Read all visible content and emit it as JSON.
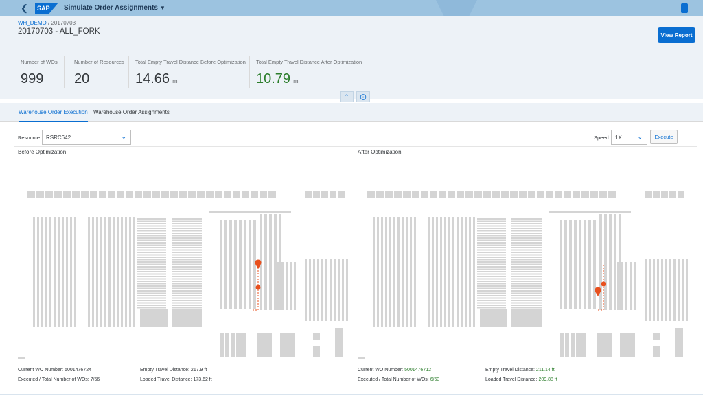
{
  "shell": {
    "logo": "SAP",
    "app_title": "Simulate Order Assignments"
  },
  "breadcrumb": {
    "link": "WH_DEMO",
    "sep": " / ",
    "current": "20170703"
  },
  "page_title": "20170703 - ALL_FORK",
  "view_report": "View Report",
  "kpis": {
    "wos": {
      "label": "Number of WOs",
      "value": "999"
    },
    "resources": {
      "label": "Number of Resources",
      "value": "20"
    },
    "before": {
      "label": "Total Empty Travel Distance Before Optimization",
      "value": "14.66",
      "unit": "mi"
    },
    "after": {
      "label": "Total Empty Travel Distance After Optimization",
      "value": "10.79",
      "unit": "mi"
    }
  },
  "tabs": [
    "Warehouse Order Execution",
    "Warehouse Order Assignments"
  ],
  "toolbar": {
    "resource_label": "Resource",
    "resource_value": "RSRC642",
    "speed_label": "Speed",
    "speed_value": "1X",
    "execute": "Execute"
  },
  "before": {
    "title": "Before Optimization",
    "wo_label": "Current WO Number:",
    "wo_value": "5001476724",
    "exec_label": "Executed / Total Number of WOs:",
    "exec_value": "7/56",
    "empty_label": "Empty Travel Distance:",
    "empty_value": "217.9 ft",
    "loaded_label": "Loaded Travel Distance:",
    "loaded_value": "173.62 ft"
  },
  "after": {
    "title": "After Optimization",
    "wo_label": "Current WO Number:",
    "wo_value": "5001476712",
    "exec_label": "Executed / Total Number of WOs:",
    "exec_value": "6/63",
    "empty_label": "Empty Travel Distance:",
    "empty_value": "211.14 ft",
    "loaded_label": "Loaded Travel Distance:",
    "loaded_value": "209.88 ft"
  },
  "colors": {
    "accent": "#0a6ed1",
    "shell": "#9cc3e0",
    "good": "#2b7d2b",
    "route": "#e8501e",
    "rack": "#d4d4d4"
  },
  "icons": {
    "back": "back-icon",
    "user": "user-icon",
    "collapse": "chevron-up-icon",
    "pin": "pin-icon",
    "dropdown": "chevron-down-icon"
  }
}
